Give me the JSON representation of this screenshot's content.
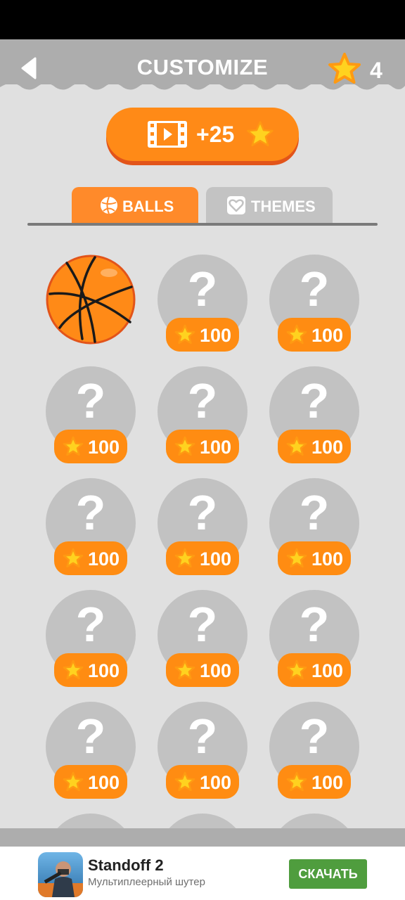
{
  "header": {
    "title": "CUSTOMIZE",
    "star_count": "4"
  },
  "video_button": {
    "reward_label": "+25"
  },
  "tabs": [
    {
      "label": "BALLS",
      "active": true
    },
    {
      "label": "THEMES",
      "active": false
    }
  ],
  "items": {
    "unlocked_ball": "basketball",
    "locked_symbol": "?",
    "price": "100"
  },
  "colors": {
    "header_bg": "#adadad",
    "accent_orange": "#ff8a17",
    "star_yellow": "#ffd21f",
    "locked_gray": "#c2c2c2",
    "install_green": "#4f9d3e"
  },
  "ad": {
    "app_name": "Standoff 2",
    "subtitle": "Мультиплеерный шутер",
    "install_label": "СКАЧАТЬ"
  },
  "icons": [
    "back-arrow-icon",
    "star-icon",
    "film-icon",
    "basketball-icon",
    "heart-icon",
    "question-mark-icon"
  ]
}
